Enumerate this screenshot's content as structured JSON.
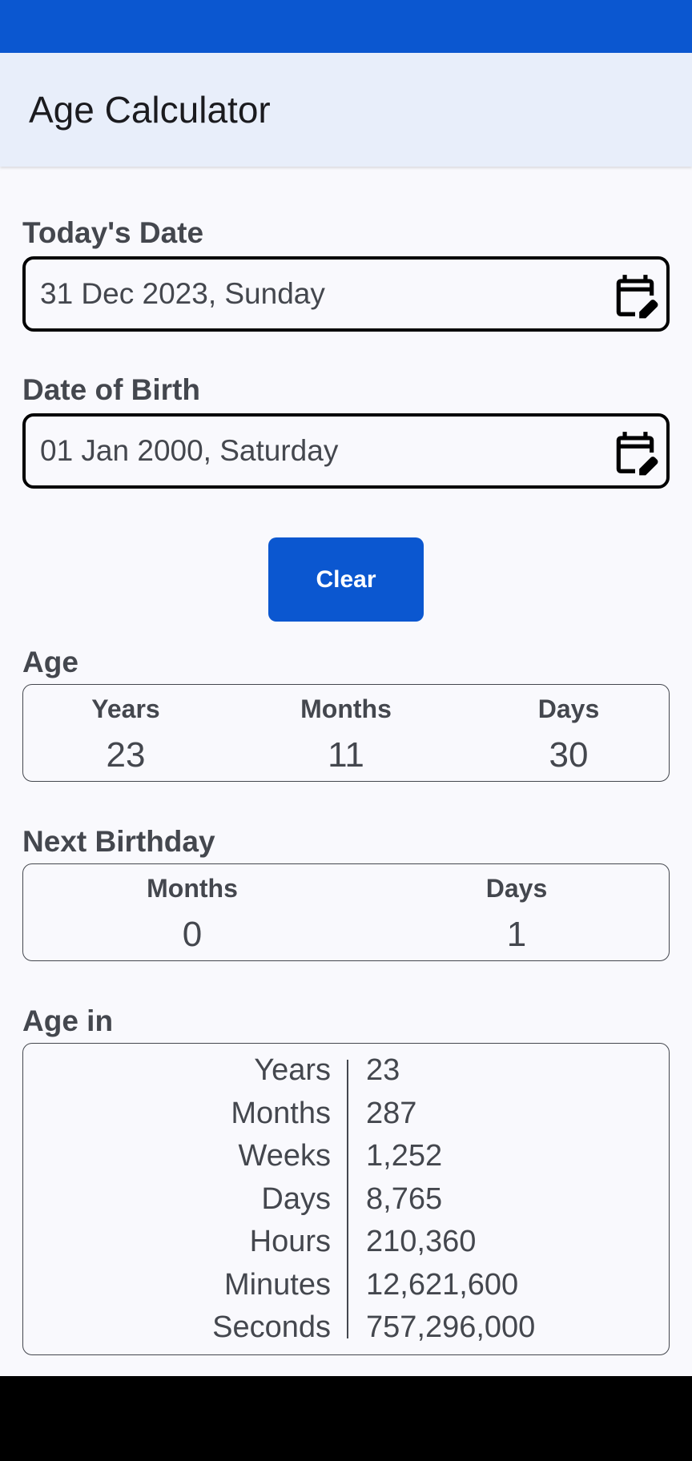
{
  "app": {
    "title": "Age Calculator"
  },
  "colors": {
    "primary": "#0b57d0",
    "app_bar": "#e8eefa",
    "background": "#f9f9fd",
    "text": "#44474e"
  },
  "todays_date": {
    "label": "Today's Date",
    "value": "31 Dec 2023, Sunday",
    "icon": "calendar-edit-icon"
  },
  "date_of_birth": {
    "label": "Date of Birth",
    "value": "01 Jan 2000, Saturday",
    "icon": "calendar-edit-icon"
  },
  "clear_label": "Clear",
  "age": {
    "title": "Age",
    "years_label": "Years",
    "years": "23",
    "months_label": "Months",
    "months": "11",
    "days_label": "Days",
    "days": "30"
  },
  "next_birthday": {
    "title": "Next Birthday",
    "months_label": "Months",
    "months": "0",
    "days_label": "Days",
    "days": "1"
  },
  "age_in": {
    "title": "Age in",
    "rows": [
      {
        "unit": "Years",
        "value": "23"
      },
      {
        "unit": "Months",
        "value": "287"
      },
      {
        "unit": "Weeks",
        "value": "1,252"
      },
      {
        "unit": "Days",
        "value": "8,765"
      },
      {
        "unit": "Hours",
        "value": "210,360"
      },
      {
        "unit": "Minutes",
        "value": "12,621,600"
      },
      {
        "unit": "Seconds",
        "value": "757,296,000"
      }
    ]
  }
}
